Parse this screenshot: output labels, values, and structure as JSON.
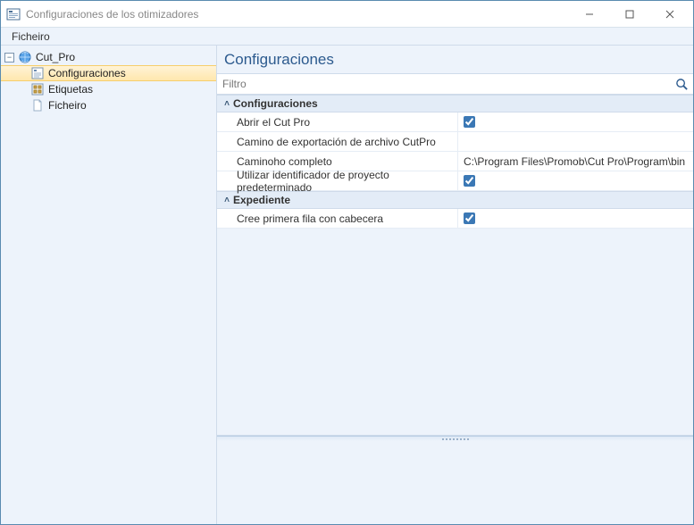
{
  "window": {
    "title": "Configuraciones de los otimizadores"
  },
  "menu": {
    "file": "Ficheiro"
  },
  "tree": {
    "root": {
      "label": "Cut_Pro",
      "expanded": true
    },
    "children": [
      {
        "id": "config",
        "label": "Configuraciones",
        "selected": true
      },
      {
        "id": "labels",
        "label": "Etiquetas",
        "selected": false
      },
      {
        "id": "file",
        "label": "Ficheiro",
        "selected": false
      }
    ]
  },
  "panel": {
    "title": "Configuraciones",
    "filter_placeholder": "Filtro"
  },
  "groups": [
    {
      "name": "Configuraciones",
      "rows": [
        {
          "label": "Abrir el Cut Pro",
          "type": "check",
          "checked": true
        },
        {
          "label": "Camino de exportación de archivo CutPro",
          "type": "text",
          "value": ""
        },
        {
          "label": "Caminoho completo",
          "type": "text",
          "value": "C:\\Program Files\\Promob\\Cut Pro\\Program\\bin"
        },
        {
          "label": "Utilizar identificador de proyecto predeterminado",
          "type": "check",
          "checked": true
        }
      ]
    },
    {
      "name": "Expediente",
      "rows": [
        {
          "label": "Cree primera fila con cabecera",
          "type": "check",
          "checked": true
        }
      ]
    }
  ]
}
